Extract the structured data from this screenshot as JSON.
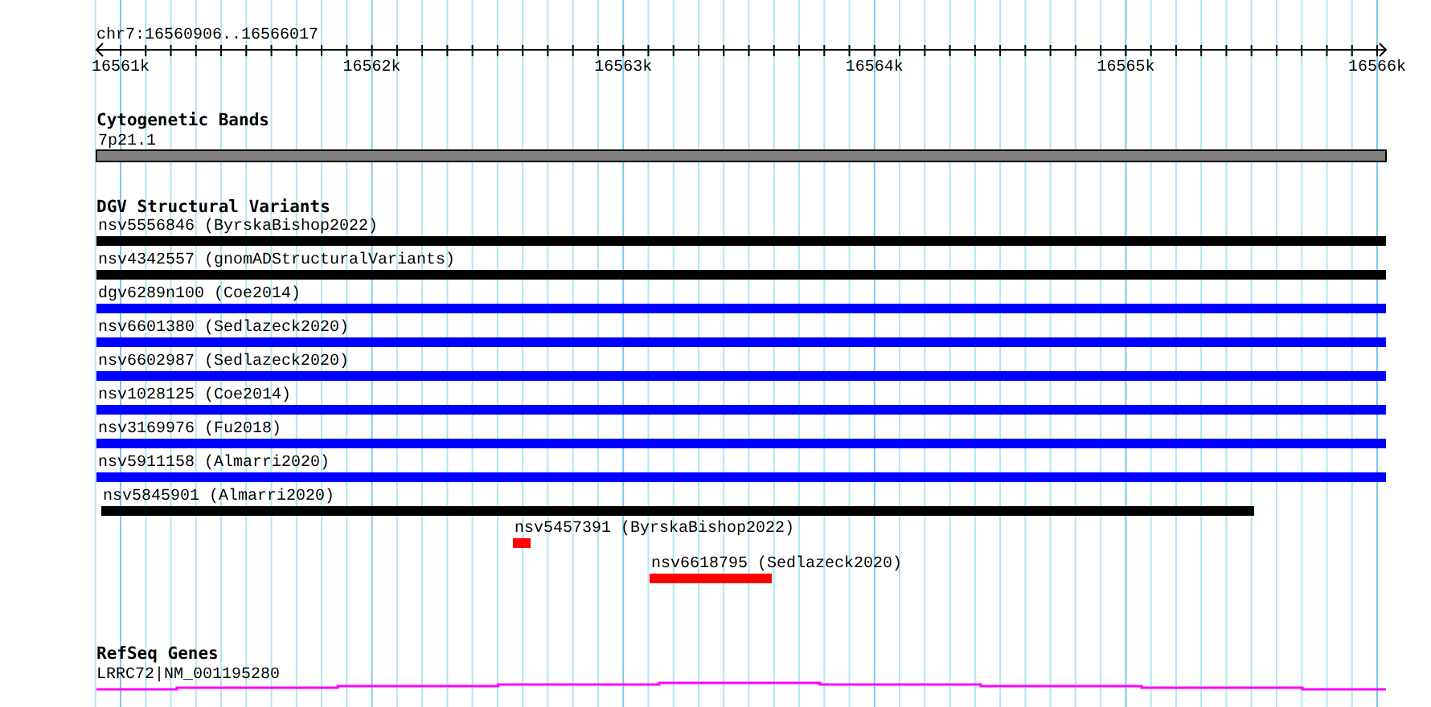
{
  "location": "chr7:16560906..16566017",
  "ruler": {
    "ticks": [
      "16561k",
      "16562k",
      "16563k",
      "16564k",
      "16565k",
      "16566k"
    ]
  },
  "tracks": [
    {
      "kind": "cytoband",
      "title": "Cytogenetic Bands",
      "features": [
        {
          "label": "7p21.1",
          "color": "#808080"
        }
      ]
    },
    {
      "kind": "variants",
      "title": "DGV Structural Variants",
      "features": [
        {
          "label": "nsv5556846 (ByrskaBishop2022)",
          "color": "#000000"
        },
        {
          "label": "nsv4342557 (gnomADStructuralVariants)",
          "color": "#000000"
        },
        {
          "label": "dgv6289n100 (Coe2014)",
          "color": "#0000ff"
        },
        {
          "label": "nsv6601380 (Sedlazeck2020)",
          "color": "#0000ff"
        },
        {
          "label": "nsv6602987 (Sedlazeck2020)",
          "color": "#0000ff"
        },
        {
          "label": "nsv1028125 (Coe2014)",
          "color": "#0000ff"
        },
        {
          "label": "nsv3169976 (Fu2018)",
          "color": "#0000ff"
        },
        {
          "label": "nsv5911158 (Almarri2020)",
          "color": "#0000ff"
        },
        {
          "label": "nsv5845901 (Almarri2020)",
          "color": "#000000"
        },
        {
          "label": "nsv5457391 (ByrskaBishop2022)",
          "color": "#ff0000"
        },
        {
          "label": "nsv6618795 (Sedlazeck2020)",
          "color": "#ff0000"
        }
      ]
    },
    {
      "kind": "genes",
      "title": "RefSeq Genes",
      "features": [
        {
          "label": "LRRC72|NM_001195280",
          "color": "#ff00ff"
        }
      ]
    }
  ]
}
